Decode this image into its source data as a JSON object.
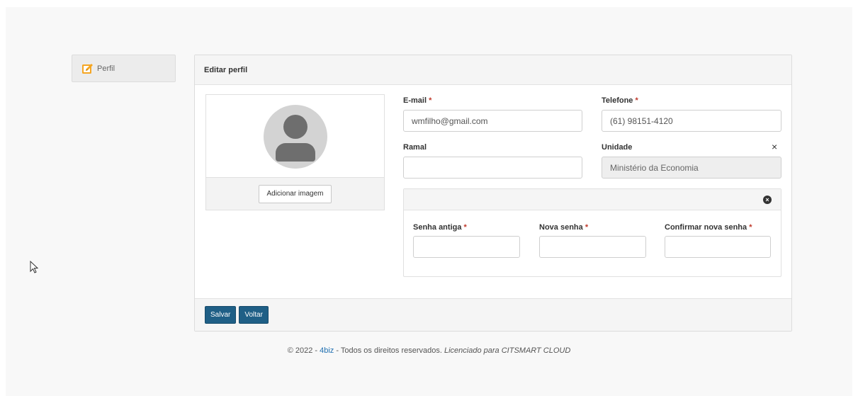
{
  "sidebar": {
    "tab_label": "Perfil",
    "icon": "edit-icon",
    "icon_color": "#f5a623"
  },
  "panel": {
    "title": "Editar perfil",
    "avatar": {
      "button_label": "Adicionar imagem"
    },
    "fields": {
      "email": {
        "label": "E-mail",
        "required_mark": "*",
        "value": "wmfilho@gmail.com"
      },
      "telefone": {
        "label": "Telefone",
        "required_mark": "*",
        "value": "(61) 98151-4120"
      },
      "ramal": {
        "label": "Ramal",
        "value": ""
      },
      "unidade": {
        "label": "Unidade",
        "value": "Ministério da Economia",
        "clear_glyph": "×"
      }
    },
    "password": {
      "senha_antiga": {
        "label": "Senha antiga",
        "required_mark": "*"
      },
      "nova_senha": {
        "label": "Nova senha",
        "required_mark": "*"
      },
      "confirmar": {
        "label": "Confirmar nova senha",
        "required_mark": "*"
      },
      "close_glyph": "×"
    },
    "buttons": {
      "save": "Salvar",
      "back": "Voltar"
    }
  },
  "footer": {
    "prefix": "© 2022 - ",
    "brand": "4biz",
    "middle": " - Todos os direitos reservados. ",
    "license": "Licenciado para CITSMART CLOUD"
  },
  "colors": {
    "primary": "#1f5f86",
    "required": "#c0392b"
  }
}
